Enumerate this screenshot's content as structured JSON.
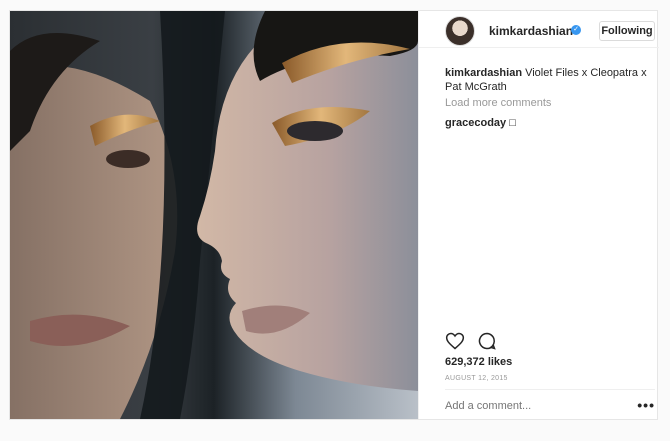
{
  "post": {
    "username": "kimkardashian",
    "follow_label": "Following",
    "caption_user": "kimkardashian",
    "caption_text": " Violet Files x Cleopatra x Pat McGrath",
    "load_more": "Load more comments",
    "comments": [
      {
        "user": "gracecoday",
        "text": " □"
      }
    ],
    "likes": "629,372 likes",
    "date": "AUGUST 12, 2015",
    "comment_placeholder": "Add a comment...",
    "more_label": "•••"
  },
  "icons": {
    "like": "heart-icon",
    "comment": "comment-icon",
    "verified": "verified-badge-icon"
  },
  "colors": {
    "link_blue": "#3897f0",
    "muted": "#999999",
    "text": "#262626"
  }
}
